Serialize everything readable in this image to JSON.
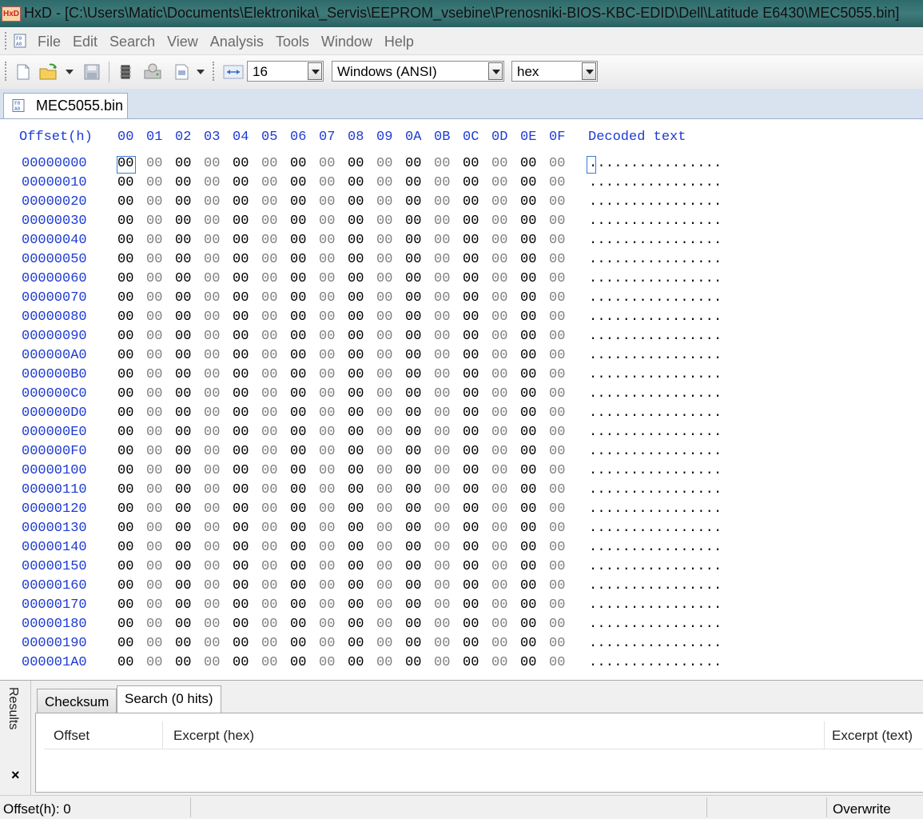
{
  "window": {
    "title": "HxD - [C:\\Users\\Matic\\Documents\\Elektronika\\_Servis\\EEPROM_vsebine\\Prenosniki-BIOS-KBC-EDID\\Dell\\Latitude E6430\\MEC5055.bin]",
    "app_icon_text": "HxD"
  },
  "menu": {
    "items": [
      "File",
      "Edit",
      "Search",
      "View",
      "Analysis",
      "Tools",
      "Window",
      "Help"
    ]
  },
  "toolbar": {
    "bytes_per_row": "16",
    "charset": "Windows (ANSI)",
    "offset_base": "hex"
  },
  "file_tab": {
    "label": "MEC5055.bin"
  },
  "hex_view": {
    "offset_header": "Offset(h)",
    "column_headers": [
      "00",
      "01",
      "02",
      "03",
      "04",
      "05",
      "06",
      "07",
      "08",
      "09",
      "0A",
      "0B",
      "0C",
      "0D",
      "0E",
      "0F"
    ],
    "decoded_header": "Decoded text",
    "rows": [
      {
        "offset": "00000000",
        "bytes": [
          "00",
          "00",
          "00",
          "00",
          "00",
          "00",
          "00",
          "00",
          "00",
          "00",
          "00",
          "00",
          "00",
          "00",
          "00",
          "00"
        ],
        "text": "................"
      },
      {
        "offset": "00000010",
        "bytes": [
          "00",
          "00",
          "00",
          "00",
          "00",
          "00",
          "00",
          "00",
          "00",
          "00",
          "00",
          "00",
          "00",
          "00",
          "00",
          "00"
        ],
        "text": "................"
      },
      {
        "offset": "00000020",
        "bytes": [
          "00",
          "00",
          "00",
          "00",
          "00",
          "00",
          "00",
          "00",
          "00",
          "00",
          "00",
          "00",
          "00",
          "00",
          "00",
          "00"
        ],
        "text": "................"
      },
      {
        "offset": "00000030",
        "bytes": [
          "00",
          "00",
          "00",
          "00",
          "00",
          "00",
          "00",
          "00",
          "00",
          "00",
          "00",
          "00",
          "00",
          "00",
          "00",
          "00"
        ],
        "text": "................"
      },
      {
        "offset": "00000040",
        "bytes": [
          "00",
          "00",
          "00",
          "00",
          "00",
          "00",
          "00",
          "00",
          "00",
          "00",
          "00",
          "00",
          "00",
          "00",
          "00",
          "00"
        ],
        "text": "................"
      },
      {
        "offset": "00000050",
        "bytes": [
          "00",
          "00",
          "00",
          "00",
          "00",
          "00",
          "00",
          "00",
          "00",
          "00",
          "00",
          "00",
          "00",
          "00",
          "00",
          "00"
        ],
        "text": "................"
      },
      {
        "offset": "00000060",
        "bytes": [
          "00",
          "00",
          "00",
          "00",
          "00",
          "00",
          "00",
          "00",
          "00",
          "00",
          "00",
          "00",
          "00",
          "00",
          "00",
          "00"
        ],
        "text": "................"
      },
      {
        "offset": "00000070",
        "bytes": [
          "00",
          "00",
          "00",
          "00",
          "00",
          "00",
          "00",
          "00",
          "00",
          "00",
          "00",
          "00",
          "00",
          "00",
          "00",
          "00"
        ],
        "text": "................"
      },
      {
        "offset": "00000080",
        "bytes": [
          "00",
          "00",
          "00",
          "00",
          "00",
          "00",
          "00",
          "00",
          "00",
          "00",
          "00",
          "00",
          "00",
          "00",
          "00",
          "00"
        ],
        "text": "................"
      },
      {
        "offset": "00000090",
        "bytes": [
          "00",
          "00",
          "00",
          "00",
          "00",
          "00",
          "00",
          "00",
          "00",
          "00",
          "00",
          "00",
          "00",
          "00",
          "00",
          "00"
        ],
        "text": "................"
      },
      {
        "offset": "000000A0",
        "bytes": [
          "00",
          "00",
          "00",
          "00",
          "00",
          "00",
          "00",
          "00",
          "00",
          "00",
          "00",
          "00",
          "00",
          "00",
          "00",
          "00"
        ],
        "text": "................"
      },
      {
        "offset": "000000B0",
        "bytes": [
          "00",
          "00",
          "00",
          "00",
          "00",
          "00",
          "00",
          "00",
          "00",
          "00",
          "00",
          "00",
          "00",
          "00",
          "00",
          "00"
        ],
        "text": "................"
      },
      {
        "offset": "000000C0",
        "bytes": [
          "00",
          "00",
          "00",
          "00",
          "00",
          "00",
          "00",
          "00",
          "00",
          "00",
          "00",
          "00",
          "00",
          "00",
          "00",
          "00"
        ],
        "text": "................"
      },
      {
        "offset": "000000D0",
        "bytes": [
          "00",
          "00",
          "00",
          "00",
          "00",
          "00",
          "00",
          "00",
          "00",
          "00",
          "00",
          "00",
          "00",
          "00",
          "00",
          "00"
        ],
        "text": "................"
      },
      {
        "offset": "000000E0",
        "bytes": [
          "00",
          "00",
          "00",
          "00",
          "00",
          "00",
          "00",
          "00",
          "00",
          "00",
          "00",
          "00",
          "00",
          "00",
          "00",
          "00"
        ],
        "text": "................"
      },
      {
        "offset": "000000F0",
        "bytes": [
          "00",
          "00",
          "00",
          "00",
          "00",
          "00",
          "00",
          "00",
          "00",
          "00",
          "00",
          "00",
          "00",
          "00",
          "00",
          "00"
        ],
        "text": "................"
      },
      {
        "offset": "00000100",
        "bytes": [
          "00",
          "00",
          "00",
          "00",
          "00",
          "00",
          "00",
          "00",
          "00",
          "00",
          "00",
          "00",
          "00",
          "00",
          "00",
          "00"
        ],
        "text": "................"
      },
      {
        "offset": "00000110",
        "bytes": [
          "00",
          "00",
          "00",
          "00",
          "00",
          "00",
          "00",
          "00",
          "00",
          "00",
          "00",
          "00",
          "00",
          "00",
          "00",
          "00"
        ],
        "text": "................"
      },
      {
        "offset": "00000120",
        "bytes": [
          "00",
          "00",
          "00",
          "00",
          "00",
          "00",
          "00",
          "00",
          "00",
          "00",
          "00",
          "00",
          "00",
          "00",
          "00",
          "00"
        ],
        "text": "................"
      },
      {
        "offset": "00000130",
        "bytes": [
          "00",
          "00",
          "00",
          "00",
          "00",
          "00",
          "00",
          "00",
          "00",
          "00",
          "00",
          "00",
          "00",
          "00",
          "00",
          "00"
        ],
        "text": "................"
      },
      {
        "offset": "00000140",
        "bytes": [
          "00",
          "00",
          "00",
          "00",
          "00",
          "00",
          "00",
          "00",
          "00",
          "00",
          "00",
          "00",
          "00",
          "00",
          "00",
          "00"
        ],
        "text": "................"
      },
      {
        "offset": "00000150",
        "bytes": [
          "00",
          "00",
          "00",
          "00",
          "00",
          "00",
          "00",
          "00",
          "00",
          "00",
          "00",
          "00",
          "00",
          "00",
          "00",
          "00"
        ],
        "text": "................"
      },
      {
        "offset": "00000160",
        "bytes": [
          "00",
          "00",
          "00",
          "00",
          "00",
          "00",
          "00",
          "00",
          "00",
          "00",
          "00",
          "00",
          "00",
          "00",
          "00",
          "00"
        ],
        "text": "................"
      },
      {
        "offset": "00000170",
        "bytes": [
          "00",
          "00",
          "00",
          "00",
          "00",
          "00",
          "00",
          "00",
          "00",
          "00",
          "00",
          "00",
          "00",
          "00",
          "00",
          "00"
        ],
        "text": "................"
      },
      {
        "offset": "00000180",
        "bytes": [
          "00",
          "00",
          "00",
          "00",
          "00",
          "00",
          "00",
          "00",
          "00",
          "00",
          "00",
          "00",
          "00",
          "00",
          "00",
          "00"
        ],
        "text": "................"
      },
      {
        "offset": "00000190",
        "bytes": [
          "00",
          "00",
          "00",
          "00",
          "00",
          "00",
          "00",
          "00",
          "00",
          "00",
          "00",
          "00",
          "00",
          "00",
          "00",
          "00"
        ],
        "text": "................"
      },
      {
        "offset": "000001A0",
        "bytes": [
          "00",
          "00",
          "00",
          "00",
          "00",
          "00",
          "00",
          "00",
          "00",
          "00",
          "00",
          "00",
          "00",
          "00",
          "00",
          "00"
        ],
        "text": "................"
      }
    ]
  },
  "results": {
    "side_label": "Results",
    "close_glyph": "×",
    "tabs": [
      "Checksum",
      "Search (0 hits)"
    ],
    "active_tab": "Search (0 hits)",
    "columns": [
      "Offset",
      "Excerpt (hex)",
      "Excerpt (text)"
    ]
  },
  "status": {
    "offset": "Offset(h): 0",
    "mode": "Overwrite"
  },
  "colors": {
    "offset_blue": "#1e3bd2",
    "odd_byte_gray": "#7f7f7f",
    "title_bar": "#3f7b7b",
    "cursor_border": "#3b7bd6"
  },
  "icons": [
    "new-file-icon",
    "open-file-icon",
    "save-icon",
    "ram-icon",
    "disk-icon",
    "file-properties-icon",
    "bytes-per-row-icon",
    "document-icon",
    "close-icon"
  ]
}
